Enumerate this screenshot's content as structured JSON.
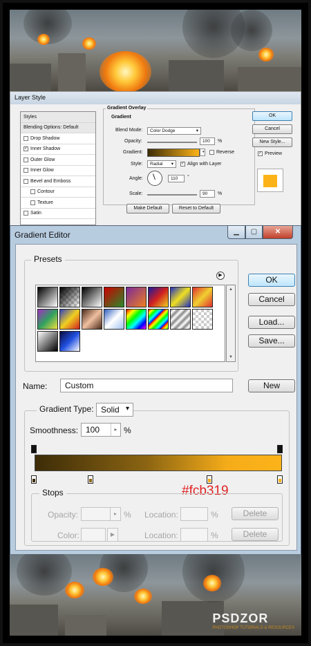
{
  "layer_style": {
    "title": "Layer Style",
    "styles_list": [
      {
        "label": "Styles",
        "kind": "header"
      },
      {
        "label": "Blending Options: Default",
        "kind": "header"
      },
      {
        "label": "Drop Shadow",
        "checked": false
      },
      {
        "label": "Inner Shadow",
        "checked": true
      },
      {
        "label": "Outer Glow",
        "checked": false
      },
      {
        "label": "Inner Glow",
        "checked": false
      },
      {
        "label": "Bevel and Emboss",
        "checked": false
      },
      {
        "label": "Contour",
        "checked": false,
        "sub": true
      },
      {
        "label": "Texture",
        "checked": false,
        "sub": true
      },
      {
        "label": "Satin",
        "checked": false
      }
    ],
    "section_title": "Gradient Overlay",
    "group_title": "Gradient",
    "blend_mode_label": "Blend Mode:",
    "blend_mode_value": "Color Dodge",
    "opacity_label": "Opacity:",
    "opacity_value": "100",
    "opacity_unit": "%",
    "gradient_label": "Gradient:",
    "reverse_label": "Reverse",
    "reverse_checked": false,
    "style_label": "Style:",
    "style_value": "Radial",
    "align_label": "Align with Layer",
    "align_checked": true,
    "angle_label": "Angle:",
    "angle_value": "110",
    "angle_unit": "°",
    "scale_label": "Scale:",
    "scale_value": "90",
    "scale_unit": "%",
    "make_default": "Make Default",
    "reset_default": "Reset to Default",
    "ok": "OK",
    "cancel": "Cancel",
    "new_style": "New Style...",
    "preview_label": "Preview",
    "preview_checked": true,
    "preview_color": "#fcb319"
  },
  "gradient_editor": {
    "title": "Gradient Editor",
    "close_icon": "close-icon",
    "presets_label": "Presets",
    "ok": "OK",
    "cancel": "Cancel",
    "load": "Load...",
    "save": "Save...",
    "name_label": "Name:",
    "name_value": "Custom",
    "new_button": "New",
    "gradient_type_label": "Gradient Type:",
    "gradient_type_value": "Solid",
    "smoothness_label": "Smoothness:",
    "smoothness_value": "100",
    "smoothness_unit": "%",
    "annotation": "#fcb319",
    "stops_label": "Stops",
    "opacity_label": "Opacity:",
    "opacity_unit": "%",
    "location_label": "Location:",
    "location_unit": "%",
    "delete_label": "Delete",
    "color_label": "Color:",
    "gradient_colors": [
      "#3d2c08",
      "#8a6412",
      "#f5ac19",
      "#fcb319"
    ]
  },
  "watermark": {
    "name": "PSDZOR",
    "tagline": "PHOTOSHOP TUTORIALS & RESOURCES"
  }
}
